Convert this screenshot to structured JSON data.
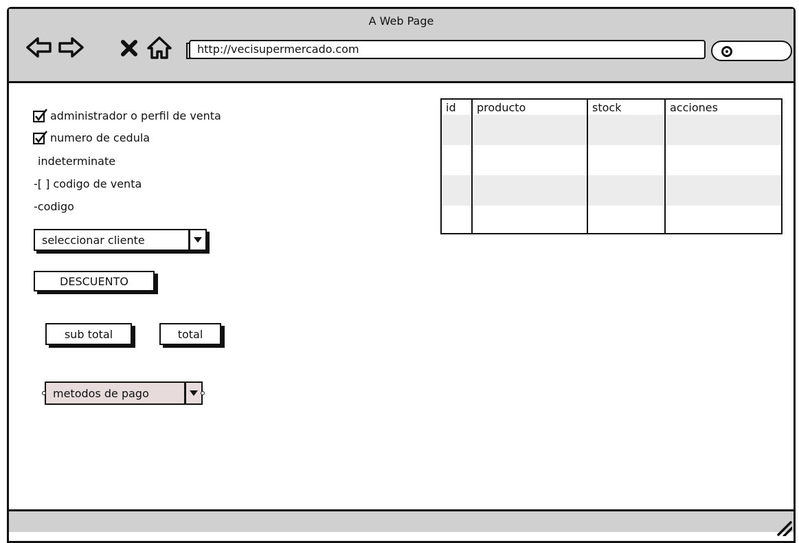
{
  "window": {
    "title": "A Web Page"
  },
  "toolbar": {
    "url": "http://vecisupermercado.com",
    "icons": [
      "back-arrow-icon",
      "forward-arrow-icon",
      "close-x-icon",
      "home-icon",
      "search-icon"
    ]
  },
  "form": {
    "checkbox_admin": {
      "label": "administrador o perfil de venta",
      "checked": true
    },
    "checkbox_cedula": {
      "label": "numero de cedula",
      "checked": true
    },
    "indeterminate_text": "indeterminate",
    "codigo_venta_text": "-[ ] codigo de venta",
    "codigo_text": "-codigo",
    "client_select": "seleccionar cliente",
    "discount_button": "DESCUENTO",
    "subtotal_button": "sub total",
    "total_button": "total",
    "payment_select": "metodos de pago"
  },
  "table": {
    "columns": [
      "id",
      "producto",
      "stock",
      "acciones"
    ],
    "rows": 4
  },
  "colors": {
    "chrome": "#d0d0d0",
    "row_shade": "#ececec",
    "payment_fill": "#e7dcdb"
  }
}
